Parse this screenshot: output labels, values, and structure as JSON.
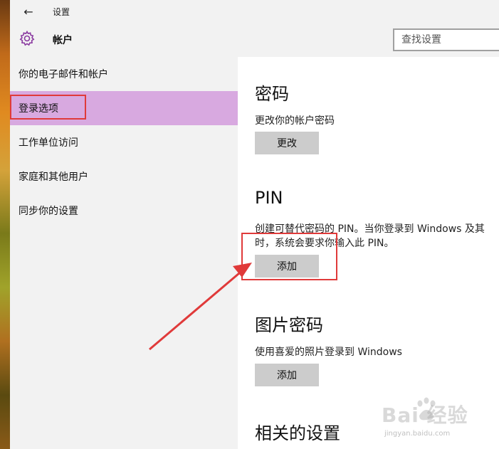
{
  "window": {
    "title": "设置"
  },
  "header": {
    "section_title": "帐户",
    "search_placeholder": "查找设置"
  },
  "sidebar": {
    "items": [
      {
        "label": "你的电子邮件和帐户",
        "selected": false
      },
      {
        "label": "登录选项",
        "selected": true
      },
      {
        "label": "工作单位访问",
        "selected": false
      },
      {
        "label": "家庭和其他用户",
        "selected": false
      },
      {
        "label": "同步你的设置",
        "selected": false
      }
    ]
  },
  "main": {
    "password": {
      "heading": "密码",
      "description": "更改你的帐户密码",
      "button": "更改"
    },
    "pin": {
      "heading": "PIN",
      "description_line1": "创建可替代密码的 PIN。当你登录到 Windows 及其",
      "description_line2": "时，系统会要求你输入此 PIN。",
      "button": "添加"
    },
    "picture_password": {
      "heading": "图片密码",
      "description": "使用喜爱的照片登录到 Windows",
      "button": "添加"
    },
    "related": {
      "heading": "相关的设置"
    }
  },
  "watermark": {
    "text": "Bai 经验",
    "subtext": "jingyan.baidu.com"
  },
  "colors": {
    "selected_nav": "#d8a9e0",
    "accent": "#8a3aa0",
    "annotation": "#e03a3a",
    "button": "#cccccc"
  },
  "icons": {
    "back": "back-arrow-icon",
    "gear": "gear-icon"
  }
}
